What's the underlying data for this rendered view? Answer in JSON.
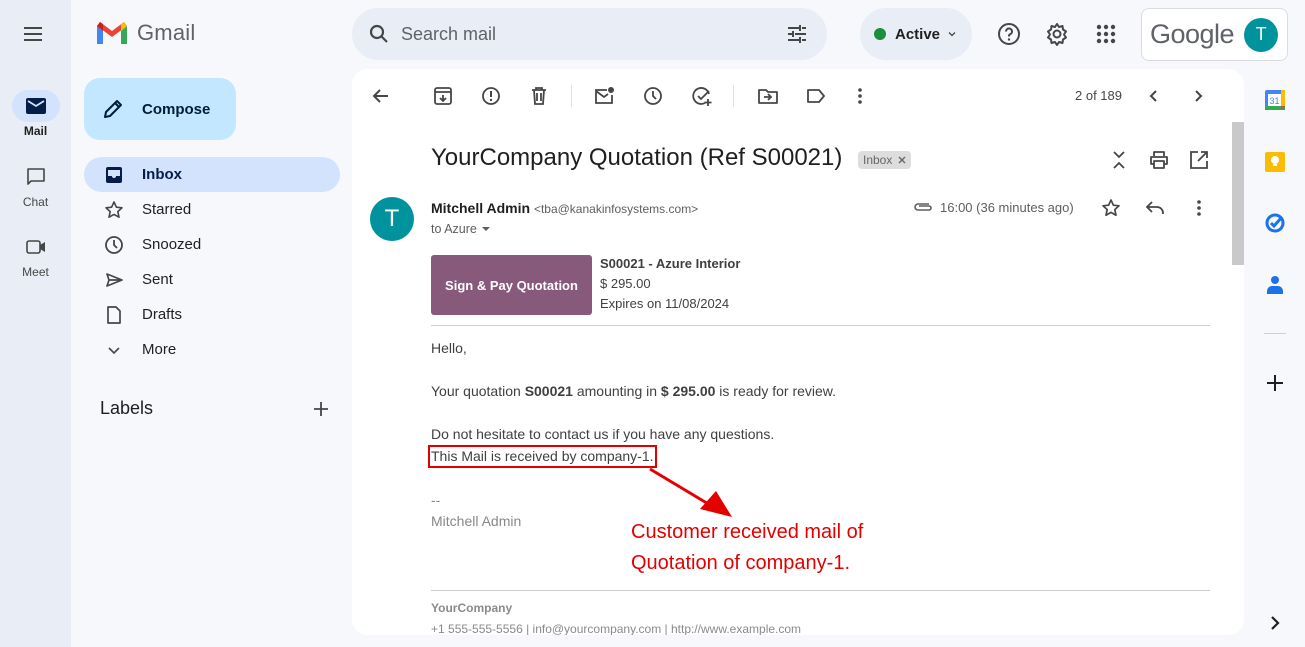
{
  "app": {
    "name": "Gmail"
  },
  "rail": {
    "items": [
      {
        "label": "Mail",
        "icon": "mail-icon",
        "active": true
      },
      {
        "label": "Chat",
        "icon": "chat-icon",
        "active": false
      },
      {
        "label": "Meet",
        "icon": "meet-icon",
        "active": false
      }
    ]
  },
  "search": {
    "placeholder": "Search mail"
  },
  "status": {
    "label": "Active",
    "color": "#1e8e3e"
  },
  "account": {
    "brand": "Google",
    "avatar_initial": "T"
  },
  "compose": {
    "label": "Compose"
  },
  "nav": {
    "items": [
      {
        "label": "Inbox",
        "icon": "inbox-icon",
        "active": true
      },
      {
        "label": "Starred",
        "icon": "star-icon"
      },
      {
        "label": "Snoozed",
        "icon": "clock-icon"
      },
      {
        "label": "Sent",
        "icon": "send-icon"
      },
      {
        "label": "Drafts",
        "icon": "draft-icon"
      },
      {
        "label": "More",
        "icon": "chevron-down-icon"
      }
    ],
    "labels_heading": "Labels"
  },
  "toolbar": {
    "pager": "2 of 189"
  },
  "email": {
    "subject": "YourCompany Quotation (Ref S00021)",
    "label_chip": "Inbox",
    "sender_initial": "T",
    "sender_name": "Mitchell Admin",
    "sender_email": "<tba@kanakinfosystems.com>",
    "to": "to Azure",
    "time": "16:00 (36 minutes ago)",
    "quote": {
      "button": "Sign & Pay Quotation",
      "title": "S00021 - Azure Interior",
      "amount": "$ 295.00",
      "expires": "Expires on 11/08/2024",
      "button_color": "#875a7b"
    },
    "body": {
      "greeting": "Hello,",
      "line1_pre": "Your quotation ",
      "line1_ref": "S00021",
      "line1_mid": " amounting in ",
      "line1_amount": "$ 295.00",
      "line1_post": " is ready for review.",
      "line2": "Do not hesitate to contact us if you have any questions.",
      "line3": "This Mail is received by company-1.",
      "sig_sep": "--",
      "sig_name": "Mitchell Admin"
    },
    "footer": {
      "company": "YourCompany",
      "info": "+1 555-555-5556 | info@yourcompany.com | http://www.example.com"
    }
  },
  "annotation": {
    "line1": "Customer received mail of",
    "line2": "Quotation of company-1.",
    "color": "#e50000"
  },
  "side_panel": {
    "apps": [
      "calendar-icon",
      "keep-icon",
      "tasks-icon",
      "contacts-icon"
    ],
    "calendar_day": "31"
  }
}
